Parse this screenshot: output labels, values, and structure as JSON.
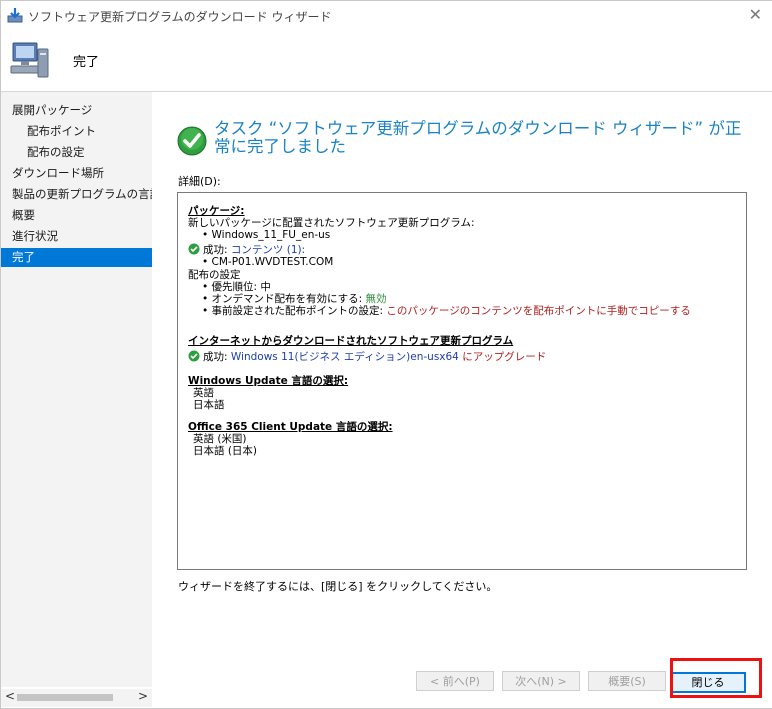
{
  "window": {
    "title": "ソフトウェア更新プログラムのダウンロード ウィザード",
    "close_icon": "close-icon"
  },
  "header": {
    "title": "完了",
    "icon": "computer-icon"
  },
  "sidebar": {
    "items": [
      {
        "label": "展開パッケージ",
        "level": "top",
        "active": false
      },
      {
        "label": "配布ポイント",
        "level": "sub",
        "active": false
      },
      {
        "label": "配布の設定",
        "level": "sub",
        "active": false
      },
      {
        "label": "ダウンロード場所",
        "level": "top",
        "active": false
      },
      {
        "label": "製品の更新プログラムの言語の",
        "level": "top",
        "active": false
      },
      {
        "label": "概要",
        "level": "top",
        "active": false
      },
      {
        "label": "進行状況",
        "level": "top",
        "active": false
      },
      {
        "label": "完了",
        "level": "top",
        "active": true
      }
    ],
    "scroll_left": "<",
    "scroll_right": ">"
  },
  "main": {
    "heading": "タスク “ソフトウェア更新プログラムのダウンロード ウィザード” が正常に完了しました",
    "details_label": "詳細(D):",
    "details": {
      "package_header": "パッケージ:",
      "package_desc": "新しいパッケージに配置されたソフトウェア更新プログラム:",
      "package_item": "• Windows_11_FU_en-us",
      "success_prefix": "成功:",
      "content_label": "コンテンツ (1):",
      "content_item": "• CM-P01.WVDTEST.COM",
      "dist_settings": "配布の設定",
      "priority": "• 優先順位: 中",
      "ondemand_label": "• オンデマンド配布を有効にする:",
      "ondemand_value": "無効",
      "prestage_label": "• 事前設定された配布ポイントの設定:",
      "prestage_value": "このパッケージのコンテンツを配布ポイントに手動でコピーする",
      "internet_header": "インターネットからダウンロードされたソフトウェア更新プログラム",
      "upgrade_text": "Windows 11(ビジネス エディション)en-usx64",
      "upgrade_suffix": "にアップグレード",
      "wu_lang_header": "Windows Update 言語の選択:",
      "wu_lang_1": "英語",
      "wu_lang_2": "日本語",
      "o365_header": "Office 365 Client Update 言語の選択:",
      "o365_lang_1": "英語 (米国)",
      "o365_lang_2": "日本語 (日本)"
    },
    "footer_text": "ウィザードを終了するには、[閉じる] をクリックしてください。"
  },
  "buttons": {
    "prev": "< 前へ(P)",
    "next": "次へ(N) >",
    "summary": "概要(S)",
    "close": "閉じる"
  },
  "colors": {
    "accent": "#0078d7",
    "heading": "#1a83c6",
    "highlight_frame": "#ee1111",
    "success_green": "#2d8f3a"
  }
}
